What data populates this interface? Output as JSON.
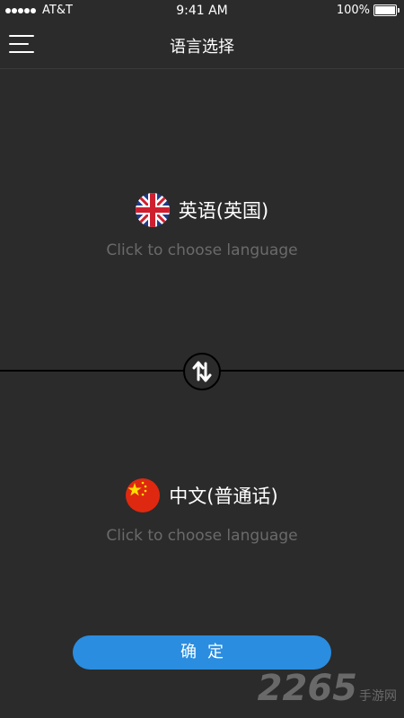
{
  "status_bar": {
    "carrier": "AT&T",
    "time": "9:41 AM",
    "battery": "100%",
    "battery_level": 1.0
  },
  "nav": {
    "title": "语言选择",
    "menu_icon": "hamburger-menu-icon"
  },
  "source_language": {
    "name": "英语(英国)",
    "hint": "Click to choose language",
    "flag_icon": "uk-flag-icon"
  },
  "target_language": {
    "name": "中文(普通话)",
    "hint": "Click to choose language",
    "flag_icon": "china-flag-icon"
  },
  "swap": {
    "icon": "swap-vertical-icon"
  },
  "confirm_button": {
    "label": "确定"
  },
  "watermark": {
    "main": "2265",
    "sub": "手游网"
  },
  "colors": {
    "background": "#2b2b2b",
    "accent": "#2a8de0",
    "hint_text": "#6a6a6a",
    "divider": "#000000"
  }
}
